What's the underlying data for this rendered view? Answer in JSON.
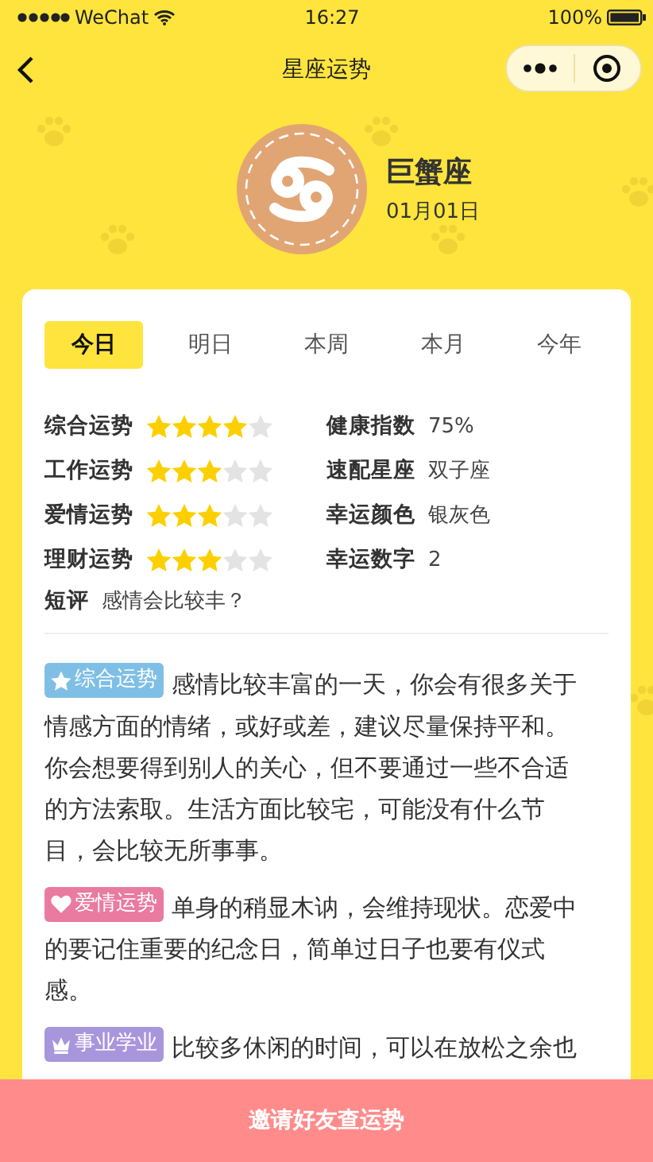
{
  "status_bar": {
    "carrier": "WeChat",
    "time": "16:27",
    "battery": "100%"
  },
  "nav": {
    "title": "星座运势"
  },
  "sign": {
    "name": "巨蟹座",
    "date": "01月01日"
  },
  "tabs": [
    {
      "label": "今日",
      "selected": true
    },
    {
      "label": "明日",
      "selected": false
    },
    {
      "label": "本周",
      "selected": false
    },
    {
      "label": "本月",
      "selected": false
    },
    {
      "label": "今年",
      "selected": false
    }
  ],
  "ratings": [
    {
      "label": "综合运势",
      "stars": 4
    },
    {
      "label": "工作运势",
      "stars": 3
    },
    {
      "label": "爱情运势",
      "stars": 3
    },
    {
      "label": "理财运势",
      "stars": 3
    }
  ],
  "facts": [
    {
      "label": "健康指数",
      "value": "75%"
    },
    {
      "label": "速配星座",
      "value": "双子座"
    },
    {
      "label": "幸运颜色",
      "value": "银灰色"
    },
    {
      "label": "幸运数字",
      "value": "2"
    }
  ],
  "review": {
    "label": "短评",
    "text": "感情会比较丰？"
  },
  "sections": [
    {
      "kind": "star",
      "tag": "综合运势",
      "color": "#7fbfe6",
      "text": "感情比较丰富的一天，你会有很多关于情感方面的情绪，或好或差，建议尽量保持平和。你会想要得到别人的关心，但不要通过一些不合适的方法索取。生活方面比较宅，可能没有什么节目，会比较无所事事。"
    },
    {
      "kind": "heart",
      "tag": "爱情运势",
      "color": "#e97aa0",
      "text": "单身的稍显木讷，会维持现状。恋爱中的要记住重要的纪念日，简单过日子也要有仪式感。"
    },
    {
      "kind": "crown",
      "tag": "事业学业",
      "color": "#a896dc",
      "text": "比较多休闲的时间，可以在放松之余也"
    }
  ],
  "invite_button": "邀请好友查运势"
}
